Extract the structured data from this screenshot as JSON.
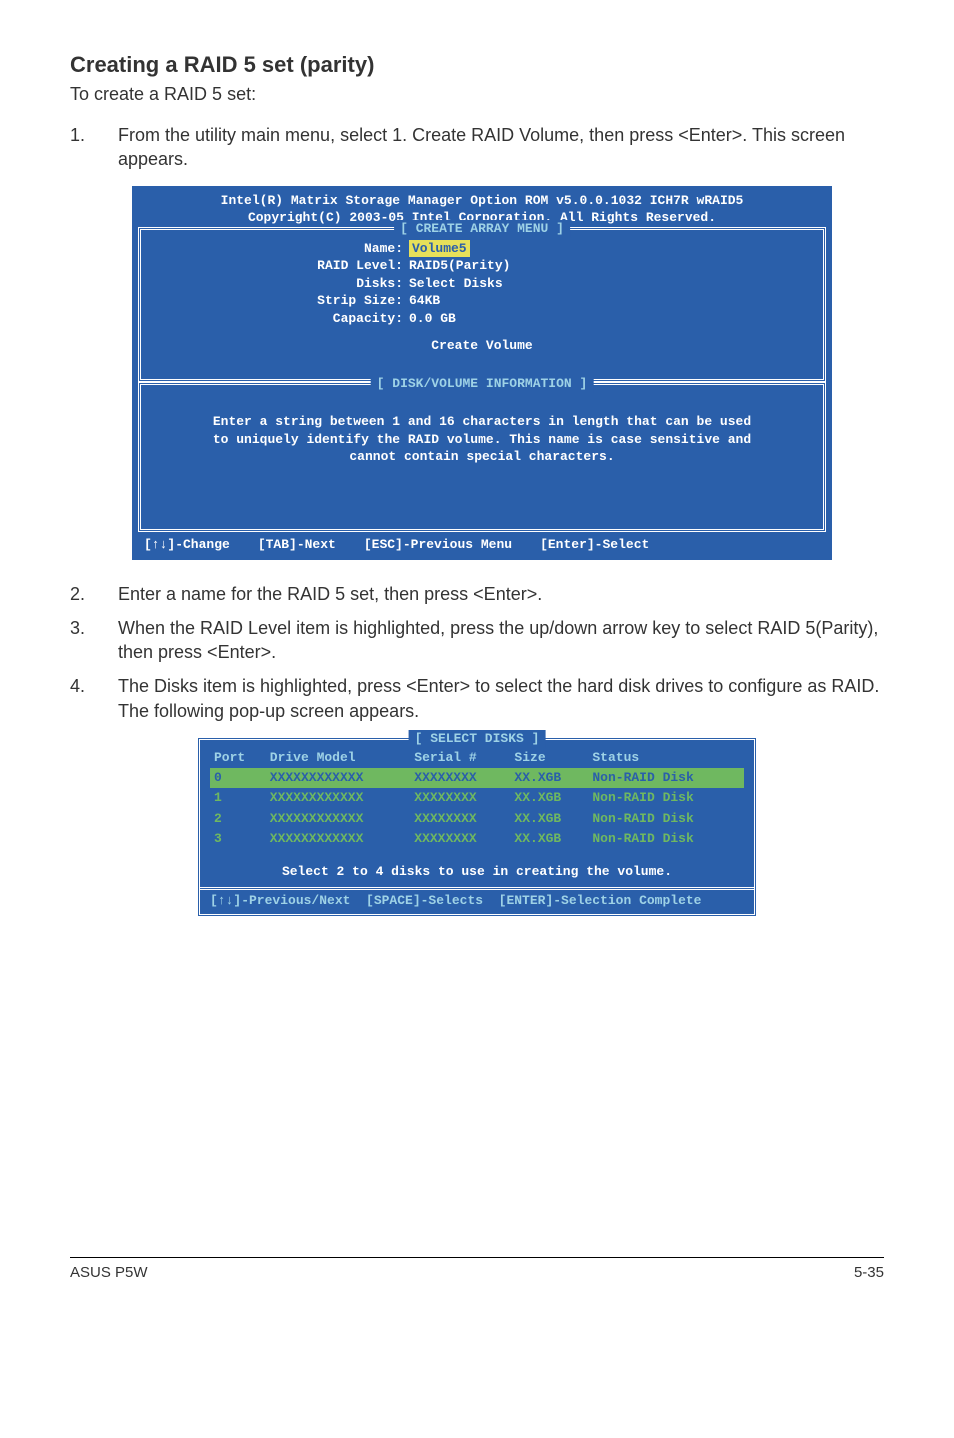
{
  "heading": "Creating a RAID 5 set (parity)",
  "intro": "To create a RAID 5 set:",
  "steps": {
    "s1": {
      "num": "1.",
      "text": "From the utility main menu, select 1. Create RAID Volume, then press <Enter>. This screen appears."
    },
    "s2": {
      "num": "2.",
      "text": "Enter a name for the RAID 5 set, then press <Enter>."
    },
    "s3": {
      "num": "3.",
      "text": "When the RAID Level item is highlighted, press the up/down arrow key to select RAID 5(Parity), then press <Enter>."
    },
    "s4": {
      "num": "4.",
      "text": "The Disks item is highlighted, press <Enter> to select the hard disk drives to configure as RAID. The following pop-up screen appears."
    }
  },
  "term1": {
    "header1": "Intel(R) Matrix Storage Manager Option ROM v5.0.0.1032 ICH7R wRAID5",
    "header2": "Copyright(C) 2003-05 Intel Corporation. All Rights Reserved.",
    "boxTitle1": "[ CREATE ARRAY MENU ]",
    "fields": {
      "name_k": "Name:",
      "name_v": "Volume5",
      "level_k": "RAID Level:",
      "level_v": "RAID5(Parity)",
      "disks_k": "Disks:",
      "disks_v": "Select Disks",
      "strip_k": "Strip Size:",
      "strip_v": "64KB",
      "cap_k": "Capacity:",
      "cap_v": "0.0  GB"
    },
    "createVolume": "Create Volume",
    "boxTitle2": "[ DISK/VOLUME INFORMATION ]",
    "help1": "Enter a string between 1 and 16 characters in length that can be used",
    "help2": "to uniquely identify the RAID volume. This name is case sensitive and",
    "help3": "cannot contain special characters.",
    "footer": {
      "a": "[↑↓]-Change",
      "b": "[TAB]-Next",
      "c": "[ESC]-Previous Menu",
      "d": "[Enter]-Select"
    }
  },
  "term2": {
    "boxTitle": "[ SELECT DISKS ]",
    "headers": {
      "port": "Port",
      "model": "Drive Model",
      "serial": "Serial #",
      "size": "Size",
      "status": "Status"
    },
    "rows": [
      {
        "port": "0",
        "model": "XXXXXXXXXXXX",
        "serial": "XXXXXXXX",
        "size": "XX.XGB",
        "status": "Non-RAID Disk"
      },
      {
        "port": "1",
        "model": "XXXXXXXXXXXX",
        "serial": "XXXXXXXX",
        "size": "XX.XGB",
        "status": "Non-RAID Disk"
      },
      {
        "port": "2",
        "model": "XXXXXXXXXXXX",
        "serial": "XXXXXXXX",
        "size": "XX.XGB",
        "status": "Non-RAID Disk"
      },
      {
        "port": "3",
        "model": "XXXXXXXXXXXX",
        "serial": "XXXXXXXX",
        "size": "XX.XGB",
        "status": "Non-RAID Disk"
      }
    ],
    "instruction": "Select 2 to 4 disks to use in creating the volume.",
    "footer": "[↑↓]-Previous/Next  [SPACE]-Selects  [ENTER]-Selection Complete"
  },
  "pageFooter": {
    "left": "ASUS P5W",
    "right": "5-35"
  }
}
